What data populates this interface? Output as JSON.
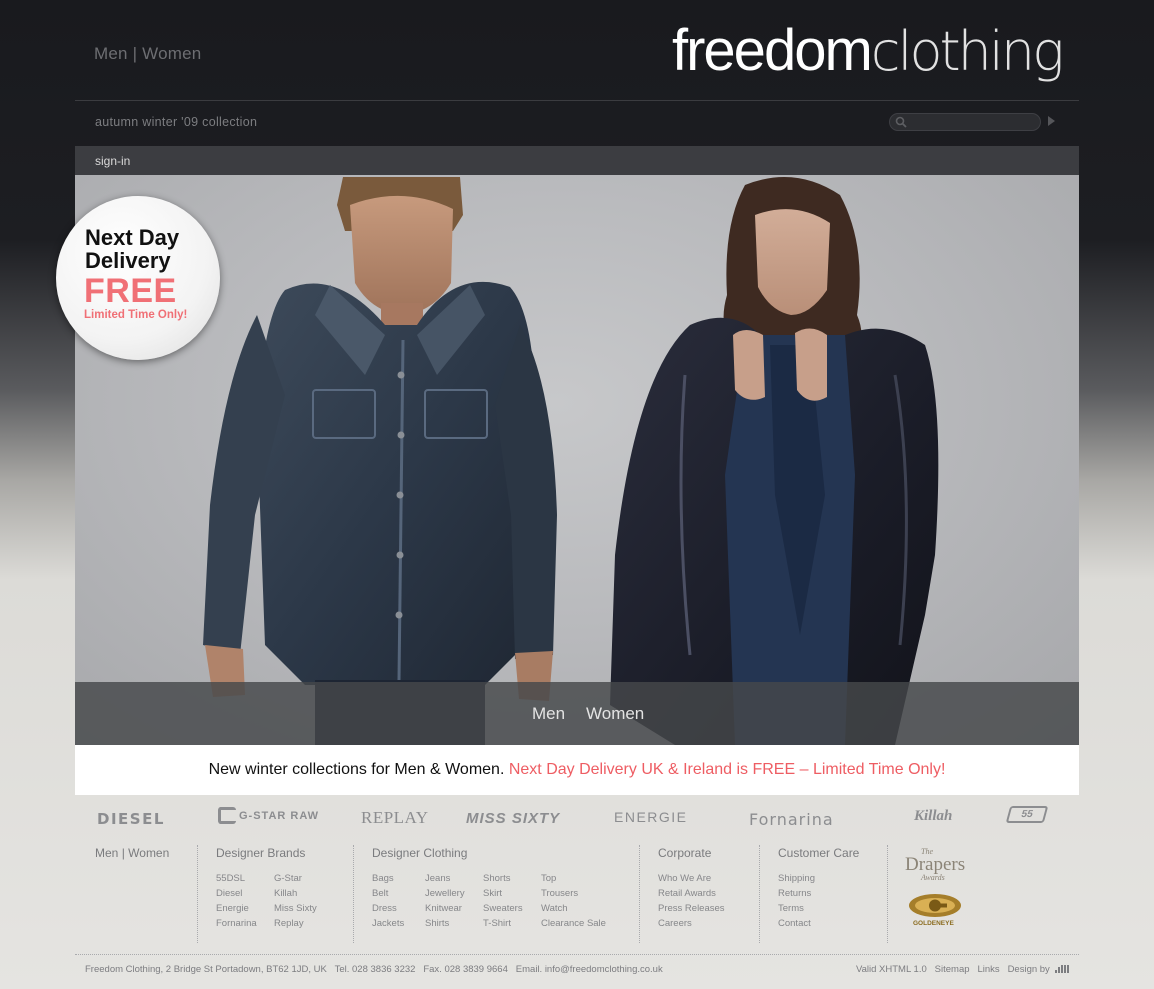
{
  "header": {
    "nav": {
      "men": "Men",
      "sep": "|",
      "women": "Women"
    },
    "logo": {
      "bold": "freedom",
      "light": "clothing"
    },
    "collection": "autumn winter '09 collection",
    "search": {
      "placeholder": ""
    },
    "signin": "sign-in"
  },
  "badge": {
    "line1": "Next Day",
    "line2": "Delivery",
    "free": "FREE",
    "limited": "Limited Time Only!",
    "accent": "#f07076"
  },
  "hero": {
    "men": "Men",
    "women": "Women"
  },
  "promo": {
    "text": "New winter collections for Men & Women.",
    "highlight": "Next Day Delivery UK & Ireland is FREE – Limited Time Only!",
    "highlight_color": "#ee5d63"
  },
  "brands": [
    "DIESEL",
    "G-STAR RAW",
    "REPLAY",
    "MISS SIXTY",
    "ENERGIE",
    "Fornarina",
    "Killah",
    "55"
  ],
  "footer": {
    "menwomen": {
      "men": "Men",
      "sep": "|",
      "women": "Women"
    },
    "designer_brands": {
      "heading": "Designer Brands",
      "col1": [
        "55DSL",
        "Diesel",
        "Energie",
        "Fornarina"
      ],
      "col2": [
        "G-Star",
        "Killah",
        "Miss Sixty",
        "Replay"
      ]
    },
    "designer_clothing": {
      "heading": "Designer Clothing",
      "col1": [
        "Bags",
        "Belt",
        "Dress",
        "Jackets"
      ],
      "col2": [
        "Jeans",
        "Jewellery",
        "Knitwear",
        "Shirts"
      ],
      "col3": [
        "Shorts",
        "Skirt",
        "Sweaters",
        "T-Shirt"
      ],
      "col4": [
        "Top",
        "Trousers",
        "Watch",
        "Clearance Sale"
      ]
    },
    "corporate": {
      "heading": "Corporate",
      "links": [
        "Who We Are",
        "Retail Awards",
        "Press Releases",
        "Careers"
      ]
    },
    "customer_care": {
      "heading": "Customer Care",
      "links": [
        "Shipping",
        "Returns",
        "Terms",
        "Contact"
      ]
    },
    "awards": {
      "drapers": "Drapers",
      "drapers_the": "The",
      "drapers_sub": "Awards",
      "goldeneye": "GOLDENEYE"
    },
    "address": "Freedom Clothing, 2 Bridge St Portadown, BT62 1JD, UK",
    "tel": "Tel. 028 3836 3232",
    "fax": "Fax. 028 3839 9664",
    "email": "Email. info@freedomclothing.co.uk",
    "valid": "Valid XHTML 1.0",
    "sitemap": "Sitemap",
    "links": "Links",
    "design_by": "Design by"
  }
}
